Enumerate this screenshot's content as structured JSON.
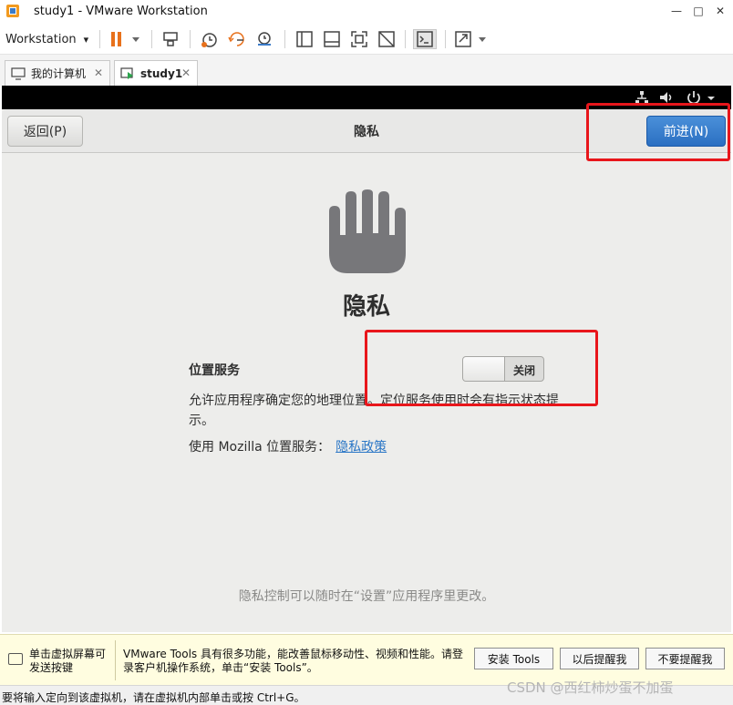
{
  "window": {
    "title": "study1 - VMware Workstation",
    "minimize": "—",
    "maximize": "□",
    "close": "✕"
  },
  "toolbar": {
    "workstation_label": "Workstation",
    "dropdown_arrow": "▾"
  },
  "tabs": [
    {
      "label": "我的计算机",
      "close": "✕"
    },
    {
      "label": "study1",
      "close": "✕"
    }
  ],
  "installer": {
    "back_label": "返回(P)",
    "header_title": "隐私",
    "next_label": "前进(N)",
    "heading": "隐私",
    "location_label": "位置服务",
    "toggle_state": "关闭",
    "description": "允许应用程序确定您的地理位置。定位服务使用时会有指示状态提示。",
    "mozilla_text": "使用  Mozilla 位置服务：",
    "policy_link": "隐私政策",
    "footer_note": "隐私控制可以随时在“设置”应用程序里更改。"
  },
  "notification": {
    "click_text": "单击虚拟屏幕可发送按键",
    "tools_text": "VMware Tools 具有很多功能，能改善鼠标移动性、视频和性能。请登录客户机操作系统，单击“安装 Tools”。",
    "install_button": "安装 Tools",
    "remind_later_button": "以后提醒我",
    "no_remind_button": "不要提醒我"
  },
  "status": {
    "message": "要将输入定向到该虚拟机，请在虚拟机内部单击或按 Ctrl+G。"
  },
  "watermark": "CSDN @西红柿炒蛋不加蛋",
  "colors": {
    "accent_blue": "#2b6fc2",
    "annotation_red": "#e8161b",
    "pause_orange": "#e8711c"
  },
  "icons": [
    "vmware-icon",
    "pause-icon",
    "send-keys-icon",
    "snapshot-icon",
    "revert-snapshot-icon",
    "manage-snapshots-icon",
    "view-console-icon",
    "fit-guest-icon",
    "fullscreen-icon",
    "unity-icon",
    "terminal-icon",
    "stretch-icon",
    "computer-icon",
    "vm-tab-icon",
    "network-icon",
    "volume-icon",
    "power-icon",
    "hand-icon",
    "keyboard-icon"
  ]
}
